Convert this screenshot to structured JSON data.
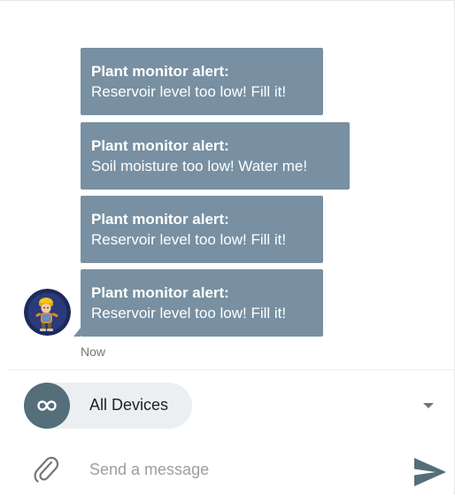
{
  "messages": [
    {
      "title": "Plant monitor alert:",
      "body": "Reservoir level too low! Fill it!"
    },
    {
      "title": "Plant monitor alert:",
      "body": "Soil moisture too low! Water me!"
    },
    {
      "title": "Plant monitor alert:",
      "body": "Reservoir level too low! Fill it!"
    },
    {
      "title": "Plant monitor alert:",
      "body": "Reservoir level too low! Fill it!"
    }
  ],
  "timestamp": "Now",
  "device_selector": {
    "icon": "infinity-icon",
    "label": "All Devices"
  },
  "compose": {
    "placeholder": "Send a message",
    "attach_icon": "paperclip-icon",
    "send_icon": "send-icon"
  },
  "colors": {
    "bubble": "#7890a2",
    "chip_bg": "#eceff1",
    "chip_icon_bg": "#546e7a"
  }
}
